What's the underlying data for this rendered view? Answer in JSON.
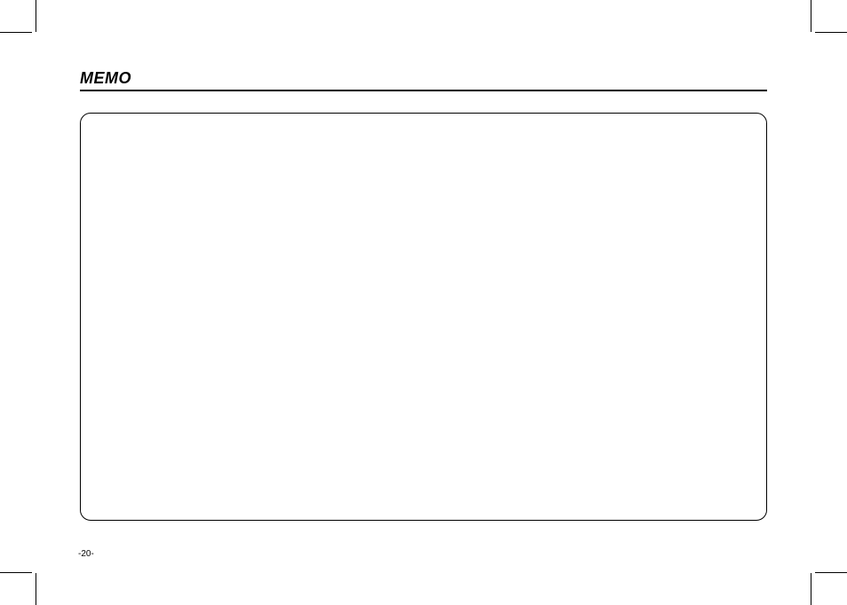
{
  "header": {
    "title": "MEMO"
  },
  "footer": {
    "page_number": "-20-"
  }
}
